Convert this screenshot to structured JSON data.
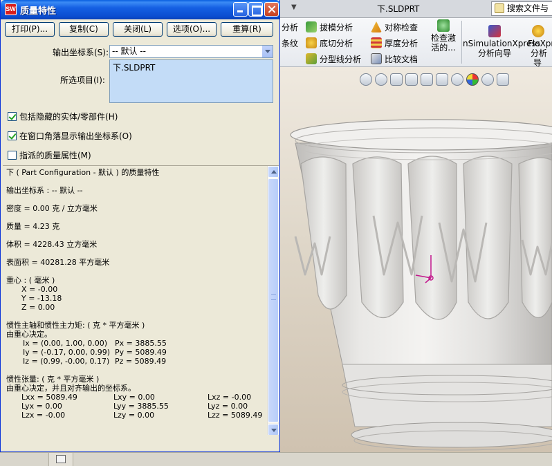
{
  "app": {
    "file_title": "下.SLDPRT",
    "search_placeholder": "搜索文件与",
    "ribbon": {
      "partial_analysis_top": "分析",
      "partial_analysis_bottom": "条纹",
      "draft_analysis": "拔模分析",
      "undercut_analysis": "底切分析",
      "parting_line_analysis": "分型线分析",
      "symmetry_check": "对称检查",
      "thickness_analysis": "厚度分析",
      "compare_documents": "比较文档",
      "check_active_line1": "检查激",
      "check_active_line2": "活的...",
      "simxpress_line1": "nSimulationXpress",
      "simxpress_line2": "分析向导",
      "floxpress_line1": "FloXpr",
      "floxpress_line2": "分析",
      "floxpress_line3": "导"
    }
  },
  "dialog": {
    "title": "质量特性",
    "buttons": {
      "print": "打印(P)...",
      "copy": "复制(C)",
      "close": "关闭(L)",
      "options": "选项(O)...",
      "recalculate": "重算(R)"
    },
    "output_coord_label": "输出坐标系(S):",
    "output_coord_value": "-- 默认 --",
    "selected_items_label": "所选项目(I):",
    "selected_items": [
      "下.SLDPRT"
    ],
    "include_hidden_label": "包括隐藏的实体/零部件(H)",
    "include_hidden_checked": true,
    "show_coord_label": "在窗口角落显示输出坐标系(O)",
    "show_coord_checked": true,
    "assigned_mass_label": "指派的质量属性(M)",
    "assigned_mass_checked": false
  },
  "results": {
    "header": "下 ( Part Configuration - 默认 ) 的质量特性",
    "output_coord": "输出坐标系 : -- 默认 --",
    "density": "密度 = 0.00 克 / 立方毫米",
    "mass": "质量 = 4.23 克",
    "volume": "体积 = 4228.43 立方毫米",
    "surface_area": "表面积 = 40281.28 平方毫米",
    "center_title": "重心 : ( 毫米 )",
    "center": [
      "X = -0.00",
      "Y = -13.18",
      "Z = 0.00"
    ],
    "principal_title": "惯性主轴和惯性主力矩: ( 克 * 平方毫米 )",
    "principal_sub": "由重心决定。",
    "principal_axes": [
      "Ix = (0.00, 1.00, 0.00)",
      "Iy = (-0.17, 0.00, 0.99)",
      "Iz = (0.99, -0.00, 0.17)"
    ],
    "principal_moments": [
      "Px = 3885.55",
      "Py = 5089.49",
      "Pz = 5089.49"
    ],
    "tensor_title": "惯性张量: ( 克 * 平方毫米 )",
    "tensor_sub": "由重心决定，并且对齐输出的坐标系。",
    "tensor_rows": [
      [
        "Lxx = 5089.49",
        "Lxy = 0.00",
        "Lxz = -0.00"
      ],
      [
        "Lyx = 0.00",
        "Lyy = 3885.55",
        "Lyz = 0.00"
      ],
      [
        "Lzx = -0.00",
        "Lzy = 0.00",
        "Lzz = 5089.49"
      ]
    ]
  },
  "colors": {
    "titlebar_blue": "#0b4dd0",
    "selection_fill": "#c3dcf7",
    "viewport_bg": "#dfd7c9",
    "triad_magenta": "#c2178c"
  }
}
